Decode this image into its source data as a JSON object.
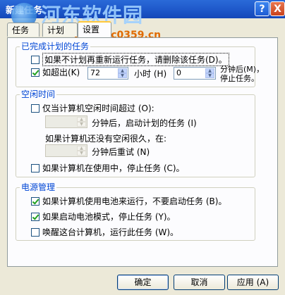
{
  "window": {
    "title": "新建任务",
    "watermark": "河东软件园",
    "watermark_url": "www.pc0359.cn"
  },
  "titlebar": {
    "help": "?",
    "close": "X"
  },
  "tabs": [
    {
      "label": "任务",
      "active": false
    },
    {
      "label": "计划",
      "active": false
    },
    {
      "label": "设置",
      "active": true
    }
  ],
  "completed": {
    "title": "已完成计划的任务",
    "delete_if_not_scheduled": "如果不计划再重新运行任务，请删除该任务(D)。",
    "stop_if_exceeds": "如超出(K)",
    "hours_value": "72",
    "hours_unit": "小时 (H)",
    "minutes_value": "0",
    "minutes_unit_line1": "分钟后(M)，",
    "minutes_unit_line2": "停止任务。"
  },
  "idle": {
    "title": "空闲时间",
    "only_if_idle_for": "仅当计算机空闲时间超过 (O):",
    "minutes_then_start": "分钟后，启动计划的任务 (I)",
    "if_not_idle_that_long": "如果计算机还没有空闲很久，在:",
    "minutes_retry": "分钟后重试 (N)",
    "stop_if_in_use": "如果计算机在使用中，停止任务 (C)。"
  },
  "power": {
    "title": "电源管理",
    "dont_start_on_battery": "如果计算机使用电池来运行，不要启动任务 (B)。",
    "stop_on_battery": "如果启动电池模式，停止任务 (Y)。",
    "wake_to_run": "唤醒这台计算机，运行此任务 (W)。"
  },
  "buttons": {
    "ok": "确定",
    "cancel": "取消",
    "apply": "应用 (A)"
  }
}
